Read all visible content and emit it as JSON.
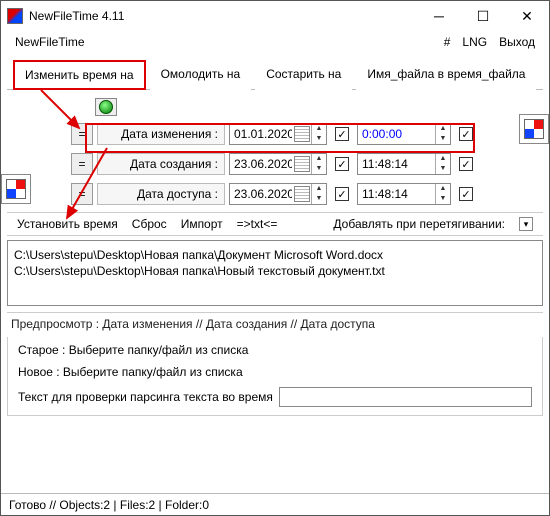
{
  "window": {
    "title": "NewFileTime 4.11"
  },
  "topmenu": {
    "app": "NewFileTime",
    "hash": "#",
    "lng": "LNG",
    "exit": "Выход"
  },
  "tabs": {
    "change": "Изменить время на",
    "young": "Омолодить на",
    "age": "Состарить на",
    "fname": "Имя_файла в время_файла"
  },
  "rows": {
    "mod": {
      "label": "Дата изменения :",
      "date": "01.01.2020",
      "time": "0:00:00"
    },
    "creat": {
      "label": "Дата создания :",
      "date": "23.06.2020",
      "time": "11:48:14"
    },
    "acc": {
      "label": "Дата доступа :",
      "date": "23.06.2020",
      "time": "11:48:14"
    }
  },
  "toolbar": {
    "set": "Установить время",
    "reset": "Сброс",
    "import": "Импорт",
    "txt": "=>txt<=",
    "drag_label": "Добавлять при перетягивании:"
  },
  "files": [
    "C:\\Users\\stepu\\Desktop\\Новая папка\\Документ Microsoft Word.docx",
    "C:\\Users\\stepu\\Desktop\\Новая папка\\Новый текстовый документ.txt"
  ],
  "preview": {
    "header": "Предпросмотр :   Дата изменения    //   Дата создания    //   Дата доступа",
    "old": "Старое :  Выберите папку/файл из списка",
    "new": "Новое :  Выберите папку/файл из списка",
    "parse_label": "Текст для проверки парсинга текста во время"
  },
  "status": "Готово // Objects:2 | Files:2 | Folder:0",
  "eq": "="
}
